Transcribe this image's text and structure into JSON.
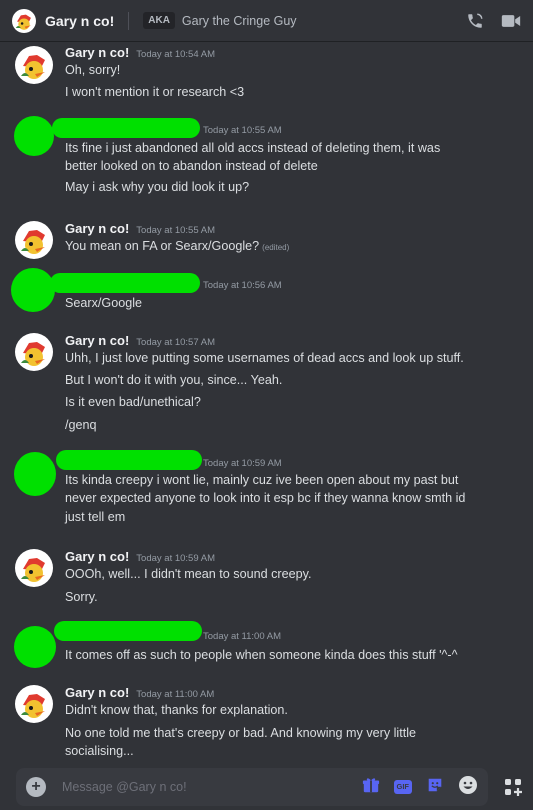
{
  "header": {
    "title": "Gary n co!",
    "aka_label": "AKA",
    "nickname": "Gary the Cringe Guy",
    "icons": [
      "call-icon",
      "video-icon"
    ]
  },
  "messages": [
    {
      "author": "Gary n co!",
      "timestamp": "Today at 10:54 AM",
      "lines": [
        "Oh, sorry!",
        "I won't mention it or research <3"
      ]
    },
    {
      "author": "",
      "timestamp": "Today at 10:55 AM",
      "lines": [
        "Its fine i just abandoned all old accs instead of deleting them, it was",
        "better looked on to abandon instead of delete",
        "May i ask why you did look it up?"
      ]
    },
    {
      "author": "Gary n co!",
      "timestamp": "Today at 10:55 AM",
      "lines": [
        "You mean on FA or Searx/Google?"
      ],
      "edited": "(edited)"
    },
    {
      "author": "",
      "timestamp": "Today at 10:56 AM",
      "lines": [
        "Searx/Google"
      ]
    },
    {
      "author": "Gary n co!",
      "timestamp": "Today at 10:57 AM",
      "lines": [
        "Uhh, I just love putting some usernames of dead accs and look up stuff.",
        "But I won't do it with you, since... Yeah.",
        "Is it even bad/unethical?",
        "/genq"
      ]
    },
    {
      "author": "",
      "timestamp": "Today at 10:59 AM",
      "lines": [
        "Its kinda creepy i wont lie, mainly cuz ive been open about my past but",
        "never expected anyone to look into it esp bc if they wanna know smth id",
        "just tell em"
      ]
    },
    {
      "author": "Gary n co!",
      "timestamp": "Today at 10:59 AM",
      "lines": [
        "OOOh, well... I didn't mean to sound creepy.",
        "Sorry."
      ]
    },
    {
      "author": "",
      "timestamp": "Today at 11:00 AM",
      "lines": [
        "It comes off as such to people when someone kinda does this stuff '^-^"
      ]
    },
    {
      "author": "Gary n co!",
      "timestamp": "Today at 11:00 AM",
      "lines": [
        "Didn't know that, thanks for explanation.",
        "No one told me that's creepy or bad. And knowing my very little",
        "socialising..."
      ]
    }
  ],
  "composer": {
    "placeholder": "Message @Gary n co!",
    "gif_label": "GIF",
    "icons": [
      "plus-icon",
      "gift-icon",
      "gif-icon",
      "sticker-icon",
      "emoji-icon",
      "apps-icon"
    ]
  },
  "colors": {
    "background": "#313338",
    "composer": "#383a40",
    "redaction": "#00e000",
    "accent": "#5865f2"
  }
}
